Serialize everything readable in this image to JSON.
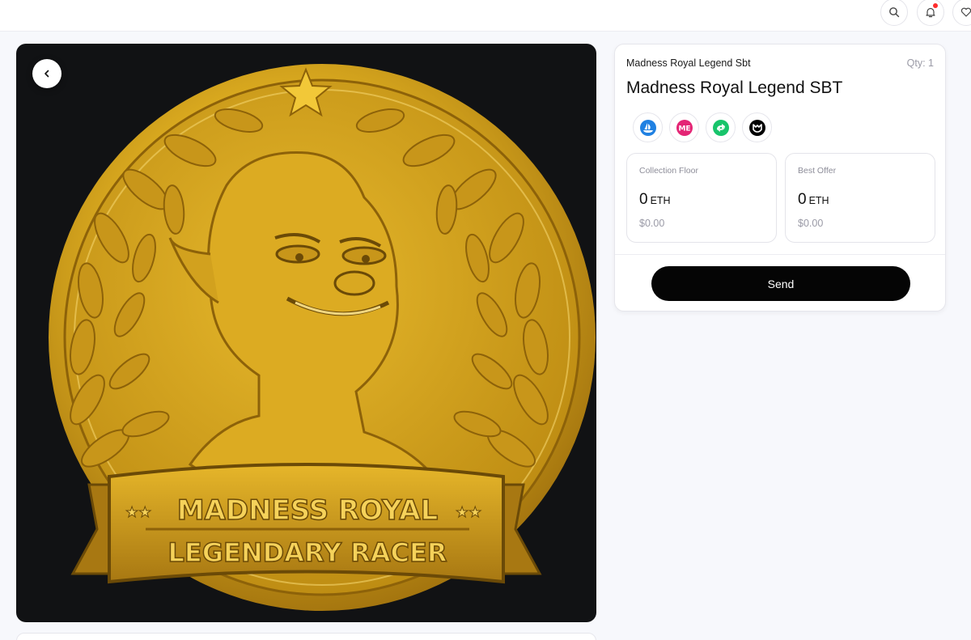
{
  "header": {
    "icons": [
      "search-icon",
      "bell-icon",
      "heart-icon"
    ],
    "notification_color": "#ff2d2d"
  },
  "media": {
    "back_icon": "chevron-left-icon",
    "coin_text_top": "MADNESS ROYAL",
    "coin_text_bottom": "LEGENDARY RACER",
    "coin_color": "#d4a51e"
  },
  "item": {
    "collection": "Madness Royal Legend Sbt",
    "qty": "Qty: 1",
    "title": "Madness Royal Legend SBT",
    "marketplaces": [
      {
        "name": "opensea-icon",
        "color": "#2081e2"
      },
      {
        "name": "magic-eden-icon",
        "color": "#e42575"
      },
      {
        "name": "rarible-icon",
        "color": "#18c46b"
      },
      {
        "name": "okx-icon",
        "color": "#000000"
      }
    ]
  },
  "stats": {
    "floor": {
      "label": "Collection Floor",
      "value": "0",
      "unit": "ETH",
      "usd": "$0.00"
    },
    "offer": {
      "label": "Best Offer",
      "value": "0",
      "unit": "ETH",
      "usd": "$0.00"
    }
  },
  "actions": {
    "send_label": "Send"
  }
}
